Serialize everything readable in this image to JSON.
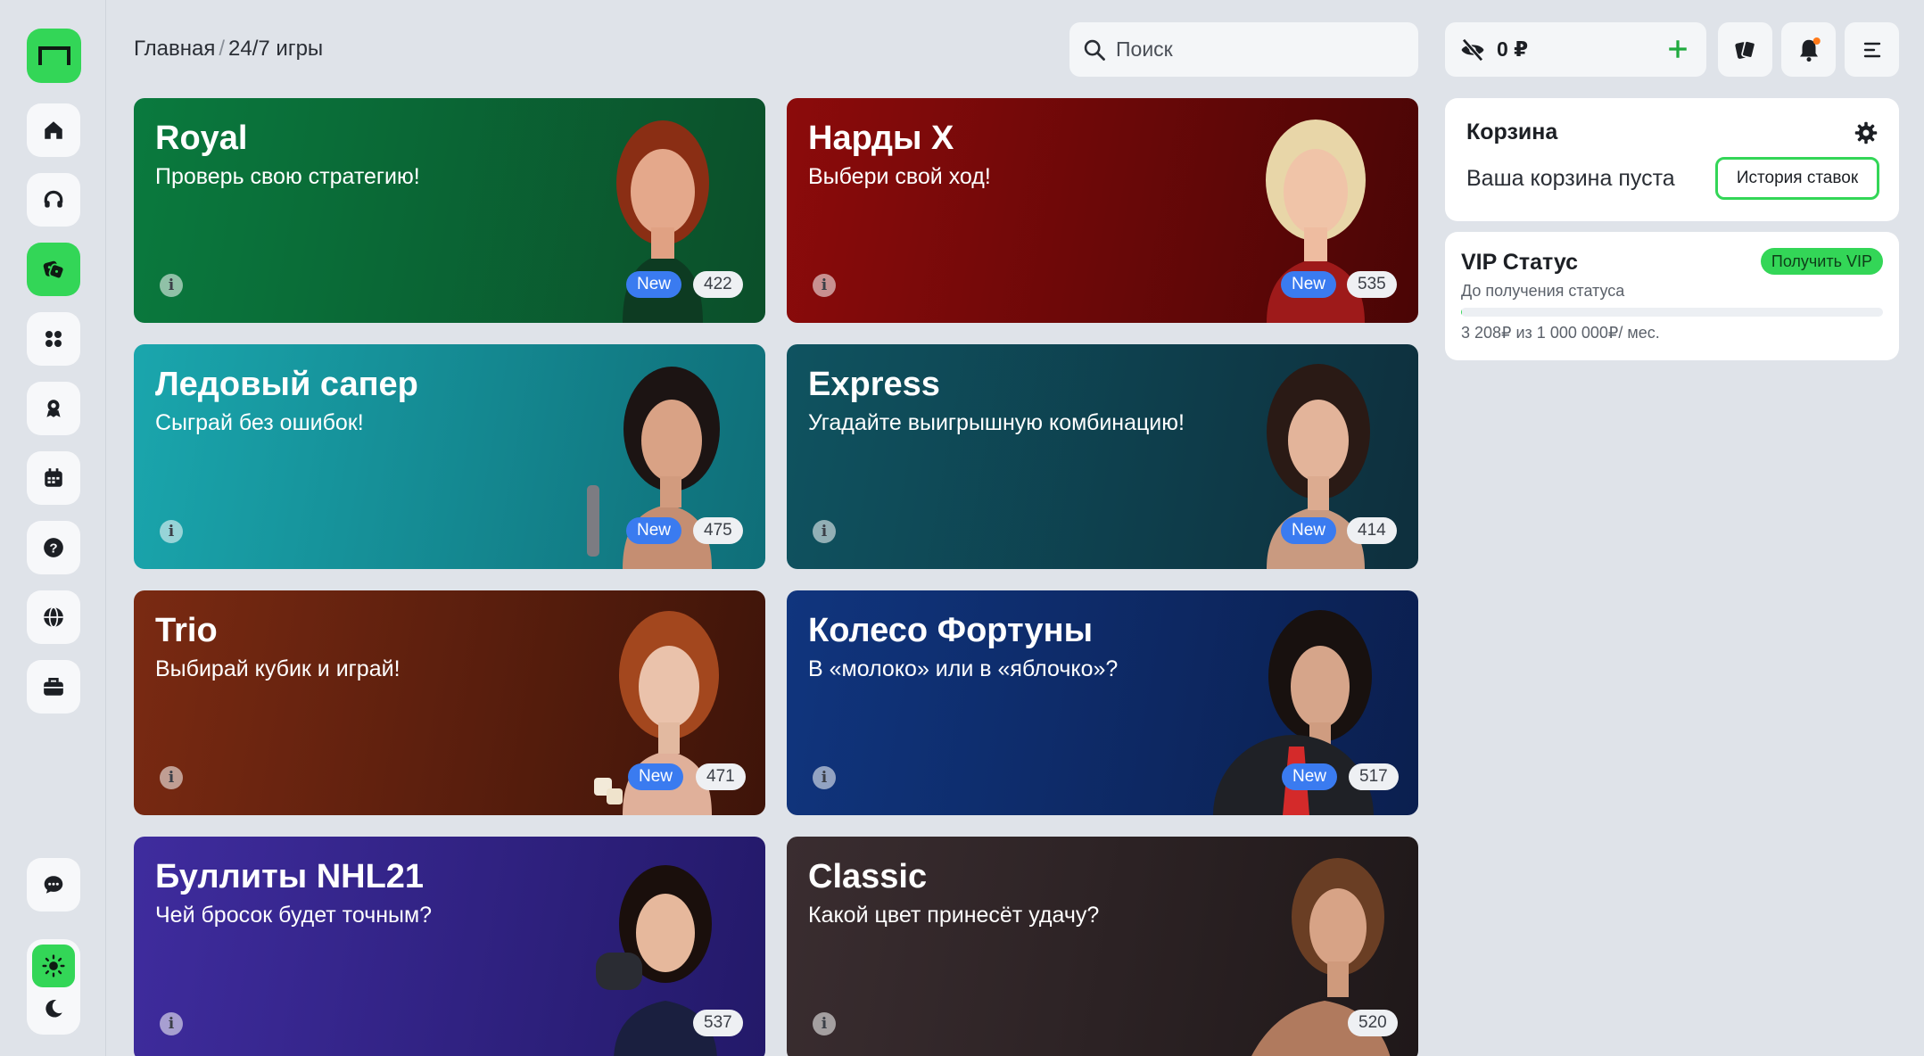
{
  "breadcrumb": {
    "home": "Главная",
    "separator": "/",
    "current": "24/7 игры"
  },
  "search": {
    "placeholder": "Поиск"
  },
  "balance": {
    "value": "0 ₽"
  },
  "sidebar": {
    "items": [
      {
        "name": "home-icon"
      },
      {
        "name": "headset-icon"
      },
      {
        "name": "dice-icon",
        "active": true
      },
      {
        "name": "apps-icon"
      },
      {
        "name": "award-icon"
      },
      {
        "name": "calendar-icon"
      },
      {
        "name": "help-icon"
      },
      {
        "name": "globe-icon"
      },
      {
        "name": "briefcase-icon"
      },
      {
        "name": "chat-icon"
      }
    ]
  },
  "games": [
    {
      "title": "Royal",
      "subtitle": "Проверь свою стратегию!",
      "badge": "New",
      "count": "422",
      "bg": [
        "#0a7a3e",
        "#0b4f2a"
      ]
    },
    {
      "title": "Нарды X",
      "subtitle": "Выбери свой ход!",
      "badge": "New",
      "count": "535",
      "bg": [
        "#8c0b0b",
        "#4a0505"
      ]
    },
    {
      "title": "Ледовый сапер",
      "subtitle": "Сыграй без ошибок!",
      "badge": "New",
      "count": "475",
      "bg": [
        "#1aa6ad",
        "#0f6e78"
      ]
    },
    {
      "title": "Express",
      "subtitle": "Угадайте выигрышную комбинацию!",
      "badge": "New",
      "count": "414",
      "bg": [
        "#0f5360",
        "#0e2f3d"
      ]
    },
    {
      "title": "Trio",
      "subtitle": "Выбирай кубик и играй!",
      "badge": "New",
      "count": "471",
      "bg": [
        "#7a2a12",
        "#3e1409"
      ]
    },
    {
      "title": "Колесо Фортуны",
      "subtitle": "В «молоко» или в «яблочко»?",
      "badge": "New",
      "count": "517",
      "bg": [
        "#10357e",
        "#0b1f4f"
      ]
    },
    {
      "title": "Буллиты NHL21",
      "subtitle": "Чей бросок будет точным?",
      "count": "537",
      "bg": [
        "#3f2c9e",
        "#231969"
      ]
    },
    {
      "title": "Classic",
      "subtitle": "Какой цвет принесёт удачу?",
      "count": "520",
      "bg": [
        "#3a2d30",
        "#1f1819"
      ]
    }
  ],
  "cart": {
    "title": "Корзина",
    "empty": "Ваша корзина пуста",
    "history_label": "История ставок"
  },
  "vip": {
    "title": "VIP Статус",
    "button": "Получить VIP",
    "subtitle": "До получения статуса",
    "progress_text": "3 208₽ из 1 000 000₽/ мес.",
    "progress_fraction": 0.003
  },
  "colors": {
    "accent": "#33d657",
    "badge_new": "#3a7bf0",
    "notification_dot": "#ff7a1a"
  }
}
